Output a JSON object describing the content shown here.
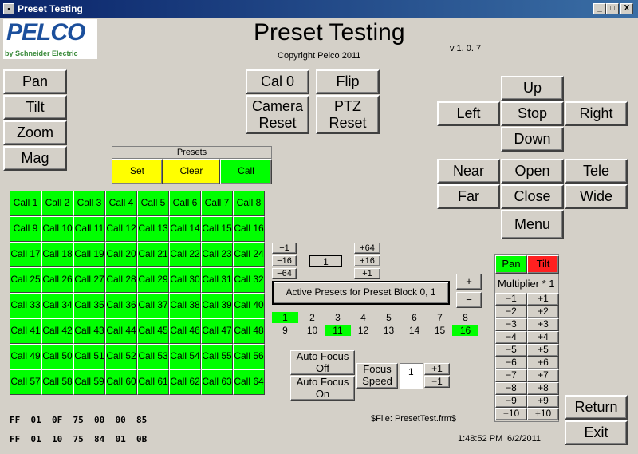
{
  "window": {
    "title": "Preset Testing",
    "min": "_",
    "max": "□",
    "close": "X"
  },
  "brand": {
    "logo": "PELCO",
    "sub": "by Schneider Electric"
  },
  "header": {
    "title": "Preset Testing",
    "copyright": "Copyright Pelco 2011",
    "version": "v 1. 0. 7"
  },
  "left_buttons": [
    "Pan",
    "Tilt",
    "Zoom",
    "Mag"
  ],
  "center_top": {
    "cal0": "Cal 0",
    "flip": "Flip",
    "camera_reset": "Camera\nReset",
    "ptz_reset": "PTZ\nReset"
  },
  "direction": {
    "up": "Up",
    "left": "Left",
    "stop": "Stop",
    "right": "Right",
    "down": "Down"
  },
  "lens": {
    "near": "Near",
    "open": "Open",
    "tele": "Tele",
    "far": "Far",
    "close": "Close",
    "wide": "Wide",
    "menu": "Menu"
  },
  "presets": {
    "header": "Presets",
    "set": "Set",
    "clear": "Clear",
    "call": "Call"
  },
  "call_grid": [
    "Call 1",
    "Call 2",
    "Call 3",
    "Call 4",
    "Call 5",
    "Call 6",
    "Call 7",
    "Call 8",
    "Call 9",
    "Call 10",
    "Call 11",
    "Call 12",
    "Call 13",
    "Call 14",
    "Call 15",
    "Call 16",
    "Call 17",
    "Call 18",
    "Call 19",
    "Call 20",
    "Call 21",
    "Call 22",
    "Call 23",
    "Call 24",
    "Call 25",
    "Call 26",
    "Call 27",
    "Call 28",
    "Call 29",
    "Call 30",
    "Call 31",
    "Call 32",
    "Call 33",
    "Call 34",
    "Call 35",
    "Call 36",
    "Call 37",
    "Call 38",
    "Call 39",
    "Call 40",
    "Call 41",
    "Call 42",
    "Call 43",
    "Call 44",
    "Call 45",
    "Call 46",
    "Call 47",
    "Call 48",
    "Call 49",
    "Call 50",
    "Call 51",
    "Call 52",
    "Call 53",
    "Call 54",
    "Call 55",
    "Call 56",
    "Call 57",
    "Call 58",
    "Call 59",
    "Call 60",
    "Call 61",
    "Call 62",
    "Call 63",
    "Call 64"
  ],
  "block": {
    "minus1": "−1",
    "minus16": "−16",
    "minus64": "−64",
    "plus64": "+64",
    "plus16": "+16",
    "plus1": "+1",
    "value": "1",
    "active_label": "Active Presets for Preset Block 0, 1",
    "plus": "+",
    "minus": "−"
  },
  "active_flags": [
    {
      "label": "1",
      "on": true
    },
    {
      "label": "2",
      "on": false
    },
    {
      "label": "3",
      "on": false
    },
    {
      "label": "4",
      "on": false
    },
    {
      "label": "5",
      "on": false
    },
    {
      "label": "6",
      "on": false
    },
    {
      "label": "7",
      "on": false
    },
    {
      "label": "8",
      "on": false
    },
    {
      "label": "9",
      "on": false
    },
    {
      "label": "10",
      "on": false
    },
    {
      "label": "11",
      "on": true
    },
    {
      "label": "12",
      "on": false
    },
    {
      "label": "13",
      "on": false
    },
    {
      "label": "14",
      "on": false
    },
    {
      "label": "15",
      "on": false
    },
    {
      "label": "16",
      "on": true
    }
  ],
  "focus": {
    "auto_off": "Auto Focus\nOff",
    "auto_on": "Auto Focus\nOn",
    "speed_label": "Focus\nSpeed",
    "speed_value": "1",
    "plus1": "+1",
    "minus1": "−1"
  },
  "multiplier": {
    "pan": "Pan",
    "tilt": "Tilt",
    "label": "Multiplier * 1",
    "minus": [
      "−1",
      "−2",
      "−3",
      "−4",
      "−5",
      "−6",
      "−7",
      "−8",
      "−9",
      "−10"
    ],
    "plus": [
      "+1",
      "+2",
      "+3",
      "+4",
      "+5",
      "+6",
      "+7",
      "+8",
      "+9",
      "+10"
    ]
  },
  "status": {
    "hex1": "FF  01  0F  75  00  00  85",
    "hex2": "FF  01  10  75  84  01  0B",
    "file": "$File: PresetTest.frm$",
    "time": "1:48:52 PM",
    "date": "6/2/2011"
  },
  "bottom_buttons": {
    "return": "Return",
    "exit": "Exit"
  },
  "colors": {
    "active": "#00ff00",
    "set": "#ffff00",
    "tilt": "#ff2020",
    "face": "#d4d0c8"
  }
}
